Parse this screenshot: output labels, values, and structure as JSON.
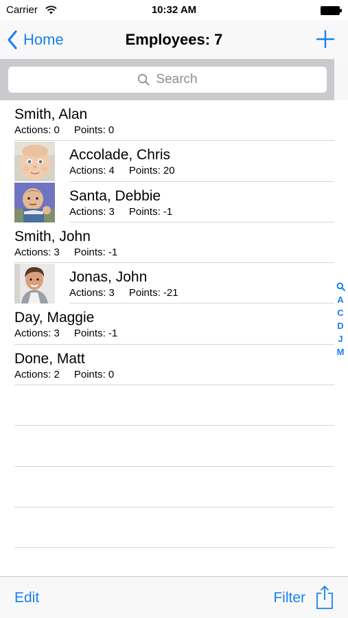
{
  "status_bar": {
    "carrier": "Carrier",
    "time": "10:32 AM"
  },
  "nav": {
    "back_label": "Home",
    "title": "Employees: 7"
  },
  "search": {
    "placeholder": "Search"
  },
  "employees": [
    {
      "name": "Smith, Alan",
      "actions": "Actions: 0",
      "points": "Points: 0",
      "photo": null
    },
    {
      "name": "Accolade, Chris",
      "actions": "Actions: 4",
      "points": "Points: 20",
      "photo": "baby-face"
    },
    {
      "name": "Santa, Debbie",
      "actions": "Actions: 3",
      "points": "Points: -1",
      "photo": "toddler-fist"
    },
    {
      "name": "Smith, John",
      "actions": "Actions: 3",
      "points": "Points: -1",
      "photo": null
    },
    {
      "name": "Jonas, John",
      "actions": "Actions: 3",
      "points": "Points: -21",
      "photo": "young-man"
    },
    {
      "name": "Day, Maggie",
      "actions": "Actions: 3",
      "points": "Points: -1",
      "photo": null
    },
    {
      "name": "Done, Matt",
      "actions": "Actions: 2",
      "points": "Points: 0",
      "photo": null
    }
  ],
  "index": {
    "letters": [
      "A",
      "C",
      "D",
      "J",
      "M"
    ]
  },
  "toolbar": {
    "edit_label": "Edit",
    "filter_label": "Filter"
  },
  "colors": {
    "accent": "#1a7ff2",
    "separator": "#d6d6d8",
    "search_bg": "#c9c9ce"
  }
}
